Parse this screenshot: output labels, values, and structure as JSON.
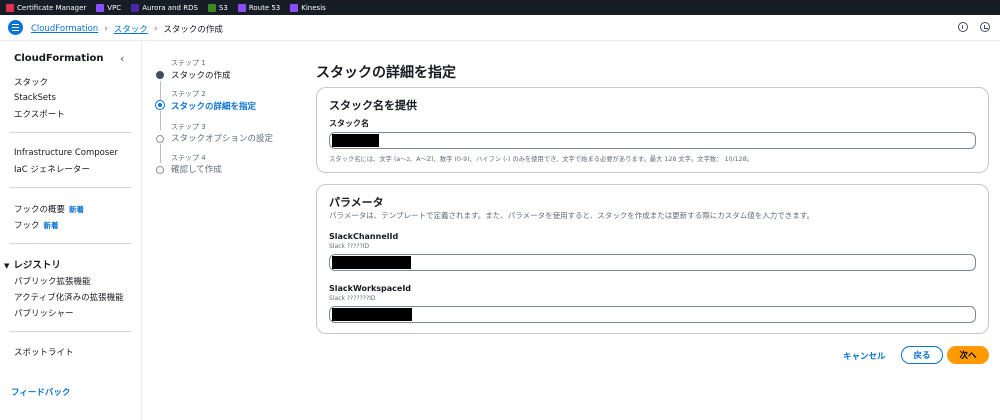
{
  "service_bar": {
    "items": [
      {
        "label": "Certificate Manager",
        "color": "#dd344c"
      },
      {
        "label": "VPC",
        "color": "#8c4fff"
      },
      {
        "label": "Aurora and RDS",
        "color": "#4d27aa"
      },
      {
        "label": "S3",
        "color": "#3f8624"
      },
      {
        "label": "Route 53",
        "color": "#8c4fff"
      },
      {
        "label": "Kinesis",
        "color": "#8c4fff"
      }
    ]
  },
  "breadcrumb": {
    "root": "CloudFormation",
    "parent": "スタック",
    "current": "スタックの作成"
  },
  "nav": {
    "title": "CloudFormation",
    "group1": [
      "スタック",
      "StackSets",
      "エクスポート"
    ],
    "group2": [
      "Infrastructure Composer",
      "IaC ジェネレーター"
    ],
    "hooks_overview": "フックの概要",
    "hooks": "フック",
    "new_badge": "新着",
    "registry_label": "レジストリ",
    "registry_items": [
      "パブリック拡張機能",
      "アクティブ化済みの拡張機能",
      "パブリッシャー"
    ],
    "spotlight": "スポットライト",
    "feedback": "フィードバック"
  },
  "steps": [
    {
      "num": "ステップ 1",
      "title": "スタックの作成",
      "state": "done"
    },
    {
      "num": "ステップ 2",
      "title": "スタックの詳細を指定",
      "state": "active"
    },
    {
      "num": "ステップ 3",
      "title": "スタックオプションの設定",
      "state": "pending"
    },
    {
      "num": "ステップ 4",
      "title": "確認して作成",
      "state": "pending"
    }
  ],
  "main": {
    "title": "スタックの詳細を指定",
    "stack_name_panel": {
      "heading": "スタック名を提供",
      "label": "スタック名",
      "hint": "スタック名には、文字 (a〜z、A〜Z)、数字 (0-9)、ハイフン (-) のみを使用でき、文字で始まる必要があります。最大 128 文字。文字数：  10/128。"
    },
    "params_panel": {
      "heading": "パラメータ",
      "desc": "パラメータは、テンプレートで定義されます。また、パラメータを使用すると、スタックを作成または更新する際にカスタム値を入力できます。",
      "params": [
        {
          "label": "SlackChannelId",
          "sub": "Slack ?????ID"
        },
        {
          "label": "SlackWorkspaceId",
          "sub": "Slack ???????ID"
        }
      ]
    }
  },
  "footer": {
    "cancel": "キャンセル",
    "back": "戻る",
    "next": "次へ"
  }
}
